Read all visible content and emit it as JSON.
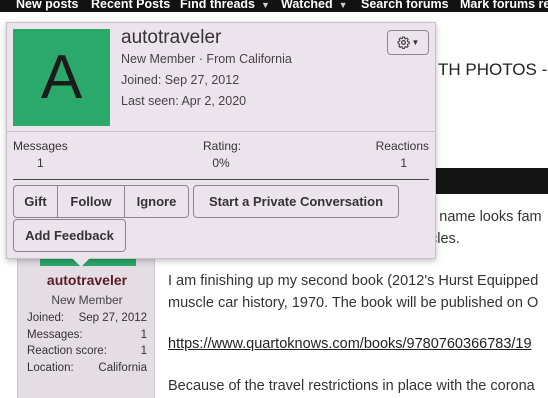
{
  "nav": {
    "items": [
      {
        "label": "New posts"
      },
      {
        "label": "Recent Posts"
      },
      {
        "label": "Find threads"
      },
      {
        "label": "Watched"
      },
      {
        "label": "Search forums"
      },
      {
        "label": "Mark forums re"
      }
    ]
  },
  "thread": {
    "title_fragment": "TH PHOTOS --"
  },
  "post": {
    "lines": [
      "y name looks fam",
      "cles.",
      "I am finishing up my second book (2012's Hurst Equipped",
      "muscle car history, 1970. The book will be published on O",
      "https://www.quartoknows.com/books/9780760366783/19",
      "Because of the travel restrictions in place with the corona"
    ]
  },
  "sidebar": {
    "username": "autotraveler",
    "title": "New Member",
    "stats": [
      {
        "label": "Joined:",
        "value": "Sep 27, 2012"
      },
      {
        "label": "Messages:",
        "value": "1"
      },
      {
        "label": "Reaction score:",
        "value": "1"
      },
      {
        "label": "Location:",
        "value": "California"
      }
    ]
  },
  "tooltip": {
    "avatar_letter": "A",
    "username": "autotraveler",
    "user_title": "New Member · From California",
    "joined": "Joined: Sep 27, 2012",
    "last_seen": "Last seen: Apr 2, 2020",
    "stats": {
      "messages_label": "Messages",
      "messages_value": "1",
      "rating_label": "Rating:",
      "rating_value": "0%",
      "reactions_label": "Reactions",
      "reactions_value": "1"
    },
    "buttons": {
      "gift": "Gift",
      "follow": "Follow",
      "ignore": "Ignore",
      "private_conversation": "Start a Private Conversation",
      "add_feedback": "Add Feedback"
    }
  },
  "colors": {
    "nav_bg": "#121212",
    "avatar_bg": "#2aa96b",
    "tooltip_bg": "#ece4ec",
    "sidebar_bg": "#e4dde4",
    "username_color": "#5a1a28"
  }
}
